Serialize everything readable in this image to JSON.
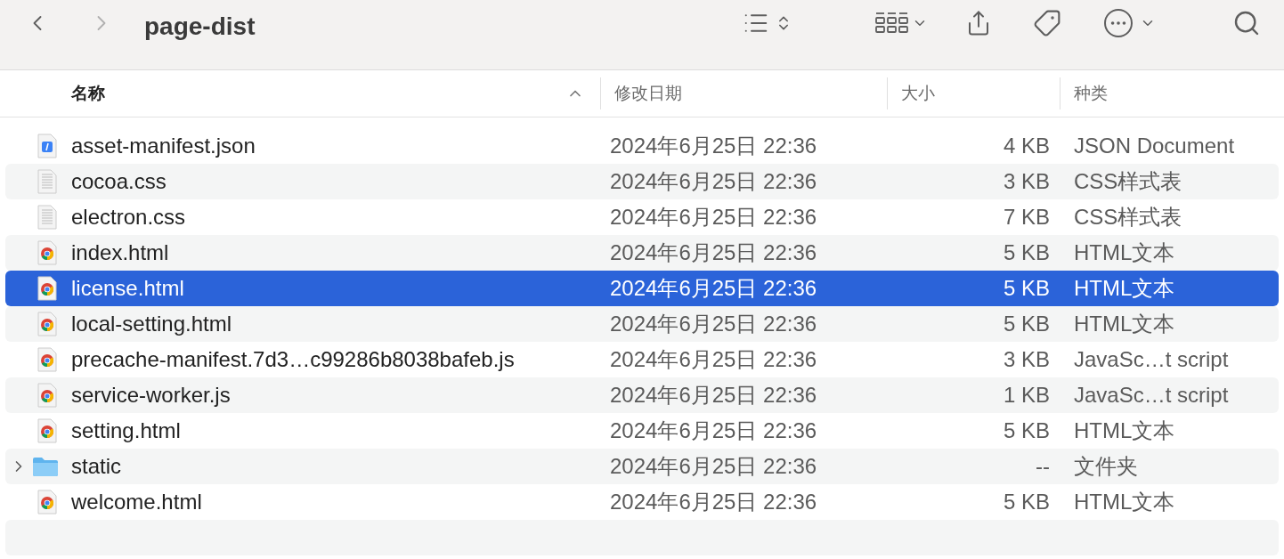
{
  "window": {
    "title": "page-dist"
  },
  "columns": [
    {
      "label": "名称",
      "sorted": true
    },
    {
      "label": "修改日期",
      "sorted": false
    },
    {
      "label": "大小",
      "sorted": false
    },
    {
      "label": "种类",
      "sorted": false
    }
  ],
  "rows": [
    {
      "kind": "json",
      "name": "asset-manifest.json",
      "date": "2024年6月25日 22:36",
      "size": "4 KB",
      "type": "JSON Document",
      "selected": false
    },
    {
      "kind": "text",
      "name": "cocoa.css",
      "date": "2024年6月25日 22:36",
      "size": "3 KB",
      "type": "CSS样式表",
      "selected": false
    },
    {
      "kind": "text",
      "name": "electron.css",
      "date": "2024年6月25日 22:36",
      "size": "7 KB",
      "type": "CSS样式表",
      "selected": false
    },
    {
      "kind": "chrome",
      "name": "index.html",
      "date": "2024年6月25日 22:36",
      "size": "5 KB",
      "type": "HTML文本",
      "selected": false
    },
    {
      "kind": "chrome",
      "name": "license.html",
      "date": "2024年6月25日 22:36",
      "size": "5 KB",
      "type": "HTML文本",
      "selected": true
    },
    {
      "kind": "chrome",
      "name": "local-setting.html",
      "date": "2024年6月25日 22:36",
      "size": "5 KB",
      "type": "HTML文本",
      "selected": false
    },
    {
      "kind": "chrome",
      "name": "precache-manifest.7d3…c99286b8038bafeb.js",
      "date": "2024年6月25日 22:36",
      "size": "3 KB",
      "type": "JavaSc…t script",
      "selected": false
    },
    {
      "kind": "chrome",
      "name": "service-worker.js",
      "date": "2024年6月25日 22:36",
      "size": "1 KB",
      "type": "JavaSc…t script",
      "selected": false
    },
    {
      "kind": "chrome",
      "name": "setting.html",
      "date": "2024年6月25日 22:36",
      "size": "5 KB",
      "type": "HTML文本",
      "selected": false
    },
    {
      "kind": "folder",
      "name": "static",
      "date": "2024年6月25日 22:36",
      "size": "--",
      "type": "文件夹",
      "selected": false,
      "expanded": false
    },
    {
      "kind": "chrome",
      "name": "welcome.html",
      "date": "2024年6月25日 22:36",
      "size": "5 KB",
      "type": "HTML文本",
      "selected": false
    }
  ]
}
